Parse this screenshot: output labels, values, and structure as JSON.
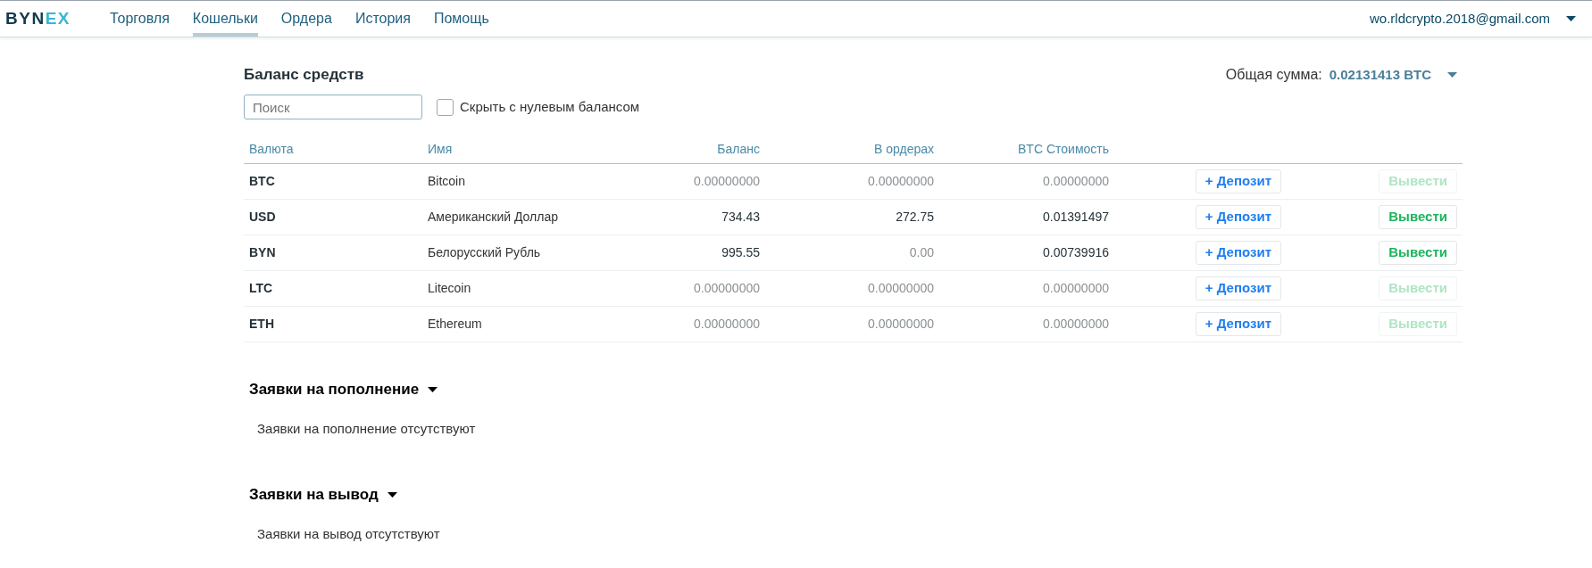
{
  "header": {
    "logo": [
      {
        "text": "BYN",
        "kind": "dark"
      },
      {
        "text": "EX",
        "kind": "accent"
      }
    ],
    "nav": [
      {
        "label": "Торговля",
        "selected": false
      },
      {
        "label": "Кошельки",
        "selected": true
      },
      {
        "label": "Ордера",
        "selected": false
      },
      {
        "label": "История",
        "selected": false
      },
      {
        "label": "Помощь",
        "selected": false
      }
    ],
    "account": "wo.rldcrypto.2018@gmail.com"
  },
  "balance": {
    "title": "Баланс средств",
    "total_label": "Общая сумма:",
    "total_value": "0.02131413 BTC",
    "search": {
      "placeholder": "Поиск"
    },
    "hide_zero": {
      "label": "Скрыть с нулевым балансом",
      "checked": false
    },
    "columns": [
      "Валюта",
      "Имя",
      "Баланс",
      "В ордерах",
      "BTC Стоимость"
    ],
    "rows": [
      {
        "currency": "BTC",
        "name": "Bitcoin",
        "balance": {
          "text": "0.00000000",
          "muted": true
        },
        "orders": {
          "text": "0.00000000",
          "muted": true
        },
        "btc": {
          "text": "0.00000000",
          "muted": true
        },
        "deposit": "+ Депозит",
        "withdraw": {
          "label": "Вывести",
          "disabled": true
        }
      },
      {
        "currency": "USD",
        "name": "Американский Доллар",
        "balance": {
          "text": "734.43",
          "muted": false
        },
        "orders": {
          "text": "272.75",
          "muted": false
        },
        "btc": {
          "text": "0.01391497",
          "muted": false
        },
        "deposit": "+ Депозит",
        "withdraw": {
          "label": "Вывести",
          "disabled": false
        }
      },
      {
        "currency": "BYN",
        "name": "Белорусский Рубль",
        "balance": {
          "text": "995.55",
          "muted": false
        },
        "orders": {
          "text": "0.00",
          "muted": true
        },
        "btc": {
          "text": "0.00739916",
          "muted": false
        },
        "deposit": "+ Депозит",
        "withdraw": {
          "label": "Вывести",
          "disabled": false
        }
      },
      {
        "currency": "LTC",
        "name": "Litecoin",
        "balance": {
          "text": "0.00000000",
          "muted": true
        },
        "orders": {
          "text": "0.00000000",
          "muted": true
        },
        "btc": {
          "text": "0.00000000",
          "muted": true
        },
        "deposit": "+ Депозит",
        "withdraw": {
          "label": "Вывести",
          "disabled": true
        }
      },
      {
        "currency": "ETH",
        "name": "Ethereum",
        "balance": {
          "text": "0.00000000",
          "muted": true
        },
        "orders": {
          "text": "0.00000000",
          "muted": true
        },
        "btc": {
          "text": "0.00000000",
          "muted": true
        },
        "deposit": "+ Депозит",
        "withdraw": {
          "label": "Вывести",
          "disabled": true
        }
      }
    ]
  },
  "sections": [
    {
      "title": "Заявки на пополнение",
      "expanded": true,
      "empty_text": "Заявки на пополнение отсутствуют"
    },
    {
      "title": "Заявки на вывод",
      "expanded": true,
      "empty_text": "Заявки на вывод отсутствуют"
    }
  ]
}
